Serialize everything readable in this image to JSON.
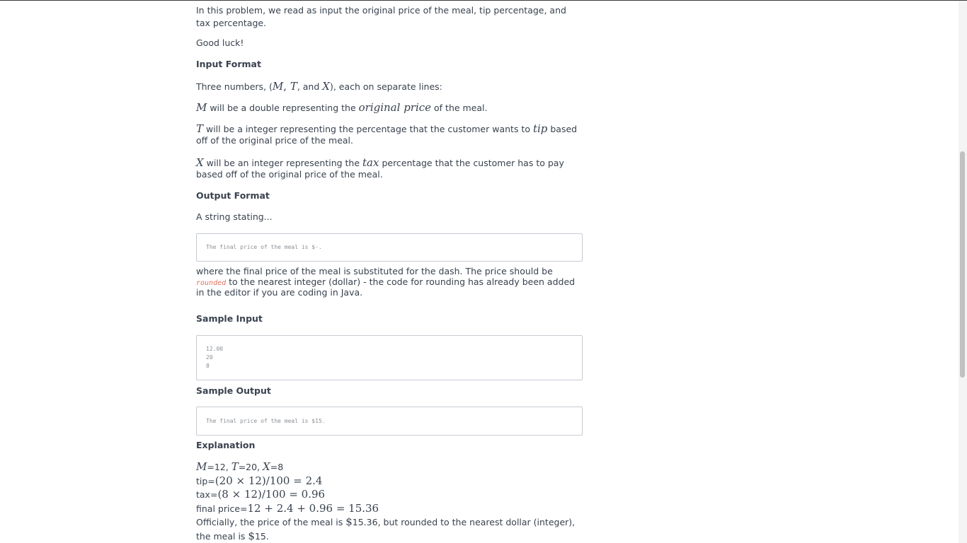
{
  "intro": "In this problem, we read as input the original price of the meal, tip percentage, and tax percentage.",
  "good_luck": "Good luck!",
  "input_format": {
    "heading": "Input Format",
    "three_pre": "Three numbers, (",
    "three_M": "M",
    "three_c1": ", ",
    "three_T": "T",
    "three_and": ", and ",
    "three_X": "X",
    "three_post": "), each on separate lines:",
    "m_var": "M",
    "m_text1": " will be a double representing the ",
    "m_math": "original price",
    "m_text2": " of the meal.",
    "t_var": "T",
    "t_text1": " will be a integer representing the percentage that the customer wants to ",
    "t_math": "tip",
    "t_text2": " based off of the original price of the meal.",
    "x_var": "X",
    "x_text1": " will be an integer representing the ",
    "x_math": "tax",
    "x_text2": " percentage that the customer has to pay based off of the original price of the meal."
  },
  "output_format": {
    "heading": "Output Format",
    "text": "A string stating...",
    "code": "The final price of the meal is $-.",
    "after1": "where the final price of the meal is substituted for the dash. The price should be ",
    "inline_code": "rounded",
    "after2": " to the nearest integer (dollar) - the code for rounding has already been added in the editor if you are coding in Java."
  },
  "sample_input": {
    "heading": "Sample Input",
    "lines": [
      "12.00",
      "20",
      "8"
    ]
  },
  "sample_output": {
    "heading": "Sample Output",
    "code": "The final price of the meal is $15."
  },
  "explanation": {
    "heading": "Explanation",
    "vals_M": "M",
    "vals_m": "=12, ",
    "vals_T": "T",
    "vals_t": "=20, ",
    "vals_X": "X",
    "vals_x": "=8",
    "tip_label": "tip=",
    "tip_expr": "(20 × 12)/100 = 2.4",
    "tax_label": "tax=",
    "tax_expr": "(8 × 12)/100 = 0.96",
    "final_label": "final price=",
    "final_expr": "12 + 2.4 + 0.96 = 15.36",
    "conclusion_1": "Officially, the price of the meal is ",
    "conclusion_amt1": "$",
    "conclusion_2": "15.36, but rounded to the nearest dollar (integer), the meal is ",
    "conclusion_amt2": "$",
    "conclusion_3": "15."
  }
}
